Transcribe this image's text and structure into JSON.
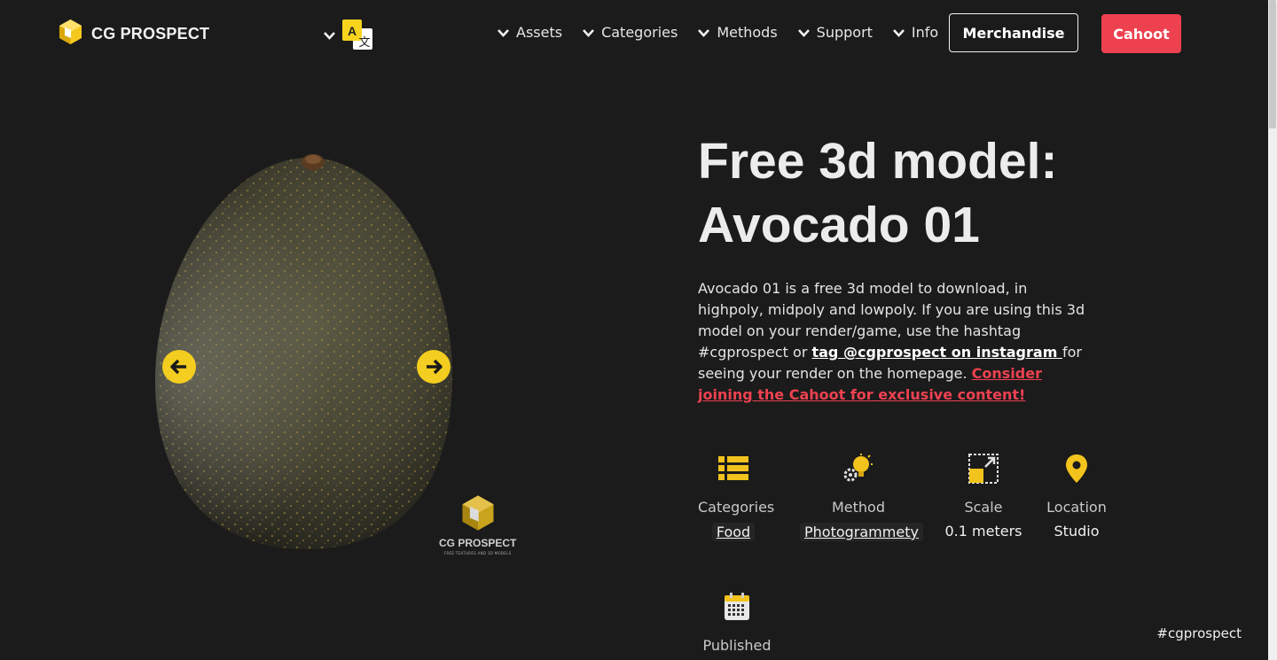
{
  "header": {
    "logo_text": "CG PROSPECT",
    "nav": [
      "Assets",
      "Categories",
      "Methods",
      "Support",
      "Info"
    ],
    "merch_label": "Merchandise",
    "cahoot_label": "Cahoot"
  },
  "viewer": {
    "watermark_title": "CG PROSPECT",
    "watermark_sub": "FREE TEXTURES AND 3D MODELS"
  },
  "content": {
    "title_line1": "Free 3d model:",
    "title_line2": "Avocado 01",
    "desc_text1": "Avocado 01 is a free 3d model to download, in highpoly, midpoly and lowpoly. If you are using this 3d model on your render/game, use the hashtag #cgprospect or ",
    "desc_link": "tag @cgprospect on instagram ",
    "desc_text2": "for seeing your render on the homepage. ",
    "desc_cta": "Consider joining the Cahoot for exclusive content!"
  },
  "stats": {
    "categories_label": "Categories",
    "categories_value": "Food",
    "method_label": "Method",
    "method_value": "Photogrammety",
    "scale_label": "Scale",
    "scale_value": "0.1 meters",
    "location_label": "Location",
    "location_value": "Studio",
    "published_label": "Published"
  },
  "hashtag": "#cgprospect",
  "colors": {
    "accent_red": "#ee4150",
    "accent_yellow": "#f3cd1f",
    "background": "#1b1b1b"
  },
  "icons": [
    "cube-logo-icon",
    "chevron-down-icon",
    "translate-icon",
    "list-icon",
    "lightbulb-gear-icon",
    "resize-icon",
    "map-pin-icon",
    "calendar-icon",
    "arrow-left-icon",
    "arrow-right-icon"
  ]
}
